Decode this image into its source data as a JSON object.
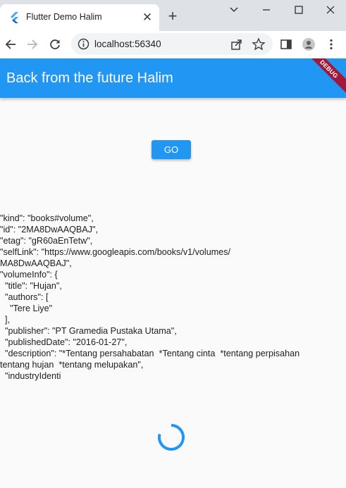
{
  "browser": {
    "tab": {
      "title": "Flutter Demo Halim",
      "favicon": "flutter-icon",
      "close": "✕"
    },
    "new_tab": "+",
    "window_controls": [
      "chevron-down-icon",
      "minimize-icon",
      "maximize-icon",
      "close-icon"
    ],
    "address": {
      "url": "localhost:56340",
      "info_icon": "info-icon"
    },
    "nav_icons": [
      "back-icon",
      "forward-icon",
      "reload-icon"
    ],
    "actions": [
      "share-icon",
      "star-icon",
      "side-panel-icon",
      "profile-icon",
      "menu-icon"
    ]
  },
  "app": {
    "title": "Back from the future Halim",
    "debug_banner": "DEBUG",
    "go_button": "GO",
    "result_text": "\"kind\": \"books#volume\",\n\"id\": \"2MA8DwAAQBAJ\",\n\"etag\": \"gR60aEnTetw\",\n\"selfLink\": \"https://www.googleapis.com/books/v1/volumes/\nMA8DwAAQBAJ\",\n\"volumeInfo\": {\n  \"title\": \"Hujan\",\n  \"authors\": [\n    \"Tere Liye\"\n  ],\n  \"publisher\": \"PT Gramedia Pustaka Utama\",\n  \"publishedDate\": \"2016-01-27\",\n  \"description\": \"*Tentang persahabatan  *Tentang cinta  *tentang perpisahan\ntentang hujan  *tentang melupakan\",\n  \"industryIdenti",
    "loading": true
  },
  "colors": {
    "primary": "#2196f3",
    "debug": "#a0193a",
    "tabstrip": "#dee1e6"
  }
}
